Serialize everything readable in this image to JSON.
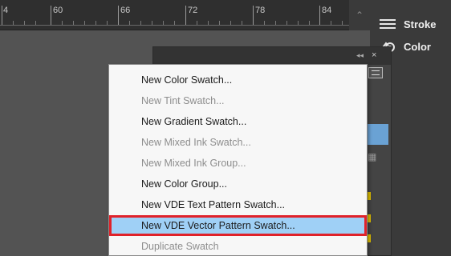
{
  "ruler": {
    "labels": [
      "4",
      "60",
      "66",
      "72",
      "78",
      "84"
    ]
  },
  "right_panel": {
    "stroke_label": "Stroke",
    "color_label": "Color"
  },
  "swatch_panel": {
    "collapse_glyph": "◂◂",
    "close_glyph": "×"
  },
  "context_menu": {
    "items": [
      {
        "label": "New Color Swatch...",
        "enabled": true,
        "selected": false
      },
      {
        "label": "New Tint Swatch...",
        "enabled": false,
        "selected": false
      },
      {
        "label": "New Gradient Swatch...",
        "enabled": true,
        "selected": false
      },
      {
        "label": "New Mixed Ink Swatch...",
        "enabled": false,
        "selected": false
      },
      {
        "label": "New Mixed Ink Group...",
        "enabled": false,
        "selected": false
      },
      {
        "label": "New Color Group...",
        "enabled": true,
        "selected": false
      },
      {
        "label": "New VDE Text Pattern Swatch...",
        "enabled": true,
        "selected": false
      },
      {
        "label": "New VDE Vector Pattern Swatch...",
        "enabled": true,
        "selected": true
      },
      {
        "label": "Duplicate Swatch",
        "enabled": false,
        "selected": false
      }
    ]
  },
  "colors": {
    "highlight": "#9fd0f6",
    "annotation_box": "#e0222a",
    "swatch_blue": "#6aa2d4",
    "swatch_yellow": "#e0c000"
  }
}
